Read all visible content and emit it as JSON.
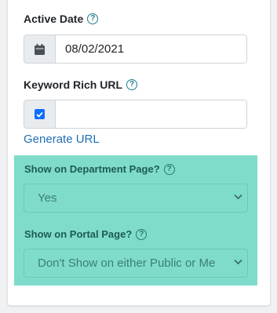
{
  "active_date": {
    "label": "Active Date",
    "value": "08/02/2021"
  },
  "keyword_url": {
    "label": "Keyword Rich URL",
    "checked": true,
    "value": "",
    "generate_link": "Generate URL"
  },
  "department_page": {
    "label": "Show on Department Page?",
    "selected": "Yes"
  },
  "portal_page": {
    "label": "Show on Portal Page?",
    "selected": "Don't Show on either Public or Me"
  },
  "colors": {
    "panel": "#7fdccb",
    "link": "#1f6fb5",
    "checkbox": "#0d6efd",
    "help_icon": "#1f7a8c"
  },
  "icons": {
    "help": "?",
    "calendar": "calendar-icon",
    "caret": "chevron-down-icon",
    "check": "check-icon"
  }
}
